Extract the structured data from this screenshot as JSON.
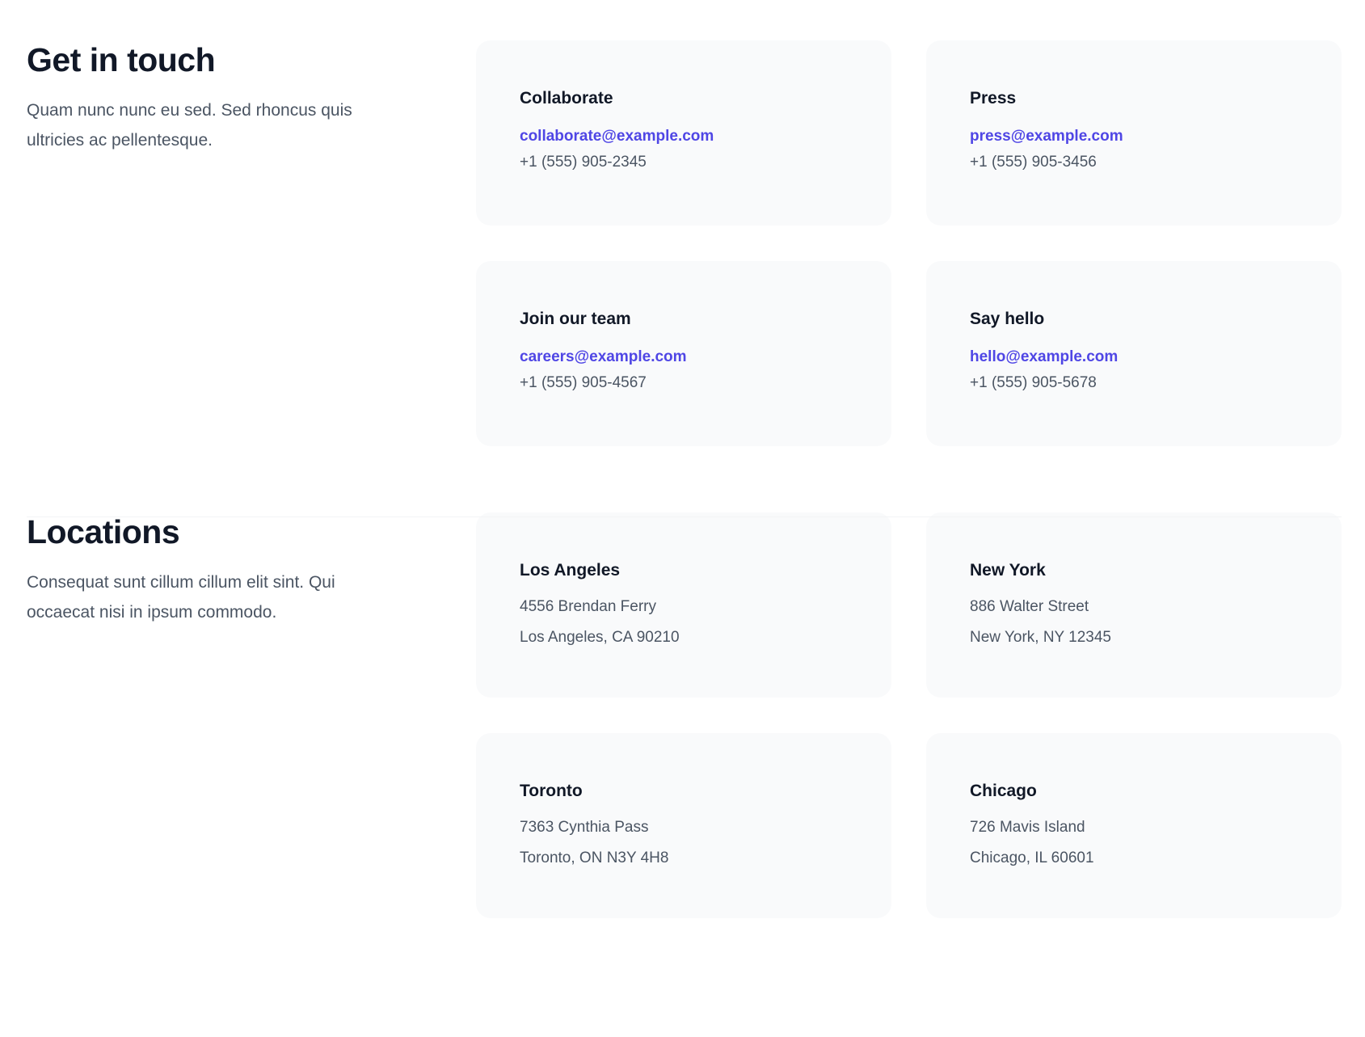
{
  "contact": {
    "title": "Get in touch",
    "description": "Quam nunc nunc eu sed. Sed rhoncus quis ultricies ac pellentesque.",
    "cards": [
      {
        "title": "Collaborate",
        "email": "collaborate@example.com",
        "phone": "+1 (555) 905-2345"
      },
      {
        "title": "Press",
        "email": "press@example.com",
        "phone": "+1 (555) 905-3456"
      },
      {
        "title": "Join our team",
        "email": "careers@example.com",
        "phone": "+1 (555) 905-4567"
      },
      {
        "title": "Say hello",
        "email": "hello@example.com",
        "phone": "+1 (555) 905-5678"
      }
    ]
  },
  "locations": {
    "title": "Locations",
    "description": "Consequat sunt cillum cillum elit sint. Qui occaecat nisi in ipsum commodo.",
    "cards": [
      {
        "title": "Los Angeles",
        "address_line1": "4556 Brendan Ferry",
        "address_line2": "Los Angeles, CA 90210"
      },
      {
        "title": "New York",
        "address_line1": "886 Walter Street",
        "address_line2": "New York, NY 12345"
      },
      {
        "title": "Toronto",
        "address_line1": "7363 Cynthia Pass",
        "address_line2": "Toronto, ON N3Y 4H8"
      },
      {
        "title": "Chicago",
        "address_line1": "726 Mavis Island",
        "address_line2": "Chicago, IL 60601"
      }
    ]
  },
  "colors": {
    "accent": "#4f46e5",
    "card_background": "#f9fafb",
    "heading": "#111827",
    "body_text": "#4b5563"
  }
}
